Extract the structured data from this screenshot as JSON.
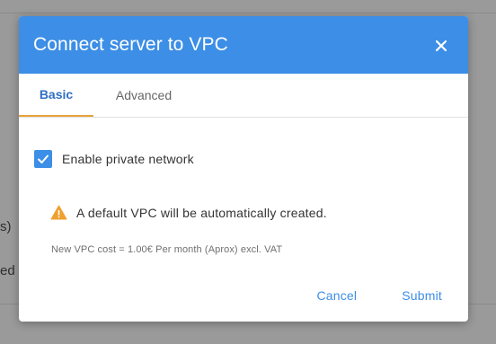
{
  "background": {
    "fragment_1": "s)",
    "fragment_2": "ed t"
  },
  "dialog": {
    "title": "Connect server to VPC",
    "close_icon": "close-icon",
    "tabs": [
      {
        "label": "Basic",
        "active": true
      },
      {
        "label": "Advanced",
        "active": false
      }
    ],
    "enable_private_network": {
      "label": "Enable private network",
      "checked": true
    },
    "warning": {
      "icon": "warning-icon",
      "text": "A default VPC will be automatically created."
    },
    "cost_note": "New VPC cost = 1.00€ Per month (Aprox) excl. VAT",
    "actions": {
      "cancel_label": "Cancel",
      "submit_label": "Submit"
    }
  },
  "colors": {
    "header": "#3c8ee6",
    "tab_active_underline": "#e8a33a",
    "tab_active_text": "#2f6fc2",
    "warning": "#f0a030",
    "backdrop": "#9a9a9a"
  }
}
